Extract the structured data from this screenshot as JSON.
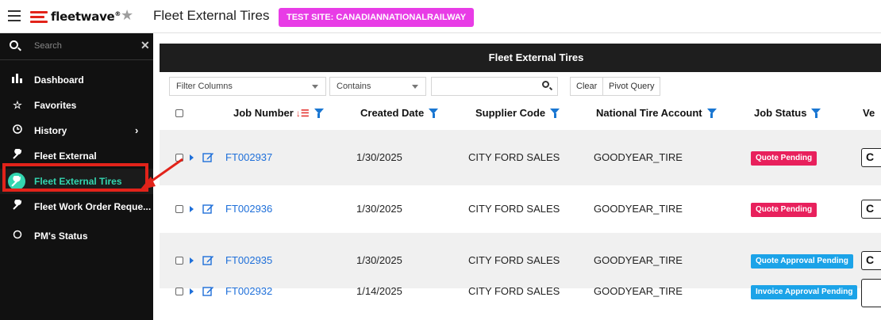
{
  "header": {
    "brand": "fleetwave",
    "brand_reg": "®",
    "title": "Fleet External Tires",
    "test_badge": "TEST SITE: CANADIANNATIONALRAILWAY"
  },
  "sidebar": {
    "search_placeholder": "Search",
    "items": [
      {
        "label": "Dashboard",
        "icon": "dashboard-icon"
      },
      {
        "label": "Favorites",
        "icon": "star-icon"
      },
      {
        "label": "History",
        "icon": "clock-icon"
      },
      {
        "label": "Fleet External",
        "icon": "wrench-icon"
      },
      {
        "label": "Fleet External Tires",
        "icon": "wrench-icon"
      },
      {
        "label": "Fleet Work Order Reque...",
        "icon": "wrench-icon"
      },
      {
        "label": "PM's Status",
        "icon": "circle-icon"
      }
    ]
  },
  "panel": {
    "title": "Fleet External Tires",
    "filter_columns": "Filter Columns",
    "operator": "Contains",
    "filter_value": "",
    "clear": "Clear",
    "pivot": "Pivot Query"
  },
  "table": {
    "columns": [
      "Job Number",
      "Created Date",
      "Supplier Code",
      "National Tire Account",
      "Job Status",
      "Ve"
    ],
    "rows": [
      {
        "job": "FT002937",
        "date": "1/30/2025",
        "supplier": "CITY FORD SALES",
        "account": "GOODYEAR_TIRE",
        "status": "Quote Pending",
        "status_color": "#e8205c",
        "v": "C"
      },
      {
        "job": "FT002936",
        "date": "1/30/2025",
        "supplier": "CITY FORD SALES",
        "account": "GOODYEAR_TIRE",
        "status": "Quote Pending",
        "status_color": "#e8205c",
        "v": "C"
      },
      {
        "job": "FT002935",
        "date": "1/30/2025",
        "supplier": "CITY FORD SALES",
        "account": "GOODYEAR_TIRE",
        "status": "Quote Approval Pending",
        "status_color": "#1ba3e8",
        "v": "C"
      },
      {
        "job": "FT002932",
        "date": "1/14/2025",
        "supplier": "CITY FORD SALES",
        "account": "GOODYEAR_TIRE",
        "status": "Invoice Approval Pending",
        "status_color": "#1ba3e8",
        "v": ""
      }
    ]
  },
  "colors": {
    "accent": "#33d6b0",
    "highlight": "#e2231a",
    "test_badge": "#e83ce6",
    "link": "#1e6fd9"
  }
}
